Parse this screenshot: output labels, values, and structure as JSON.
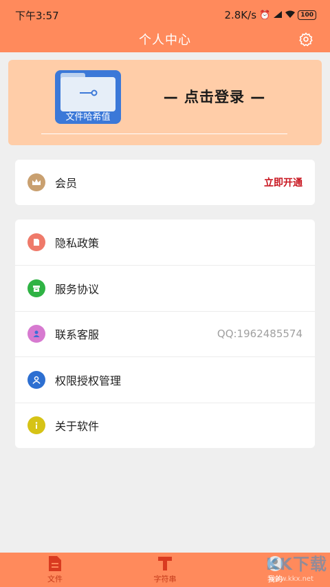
{
  "status_bar": {
    "time": "下午3:57",
    "speed": "2.8K/s",
    "battery": "100"
  },
  "header": {
    "title": "个人中心"
  },
  "login": {
    "app_icon_label": "文件哈希值",
    "prompt": "— 点击登录 —"
  },
  "member": {
    "label": "会员",
    "action": "立即开通"
  },
  "menu": {
    "items": [
      {
        "label": "隐私政策",
        "icon": "document-icon",
        "color": "#ef7a6a"
      },
      {
        "label": "服务协议",
        "icon": "archive-icon",
        "color": "#2fb344"
      },
      {
        "label": "联系客服",
        "icon": "contact-icon",
        "color": "#d77ad0",
        "value": "QQ:1962485574"
      },
      {
        "label": "权限授权管理",
        "icon": "user-icon",
        "color": "#2d6fd1"
      },
      {
        "label": "关于软件",
        "icon": "info-icon",
        "color": "#d6c316"
      }
    ]
  },
  "tab_bar": {
    "tabs": [
      {
        "label": "文件",
        "icon": "file-icon"
      },
      {
        "label": "字符串",
        "icon": "text-icon"
      },
      {
        "label": "我的",
        "icon": "profile-icon",
        "active": true
      }
    ]
  },
  "watermark": {
    "text": "KK下载",
    "sub": "www.kkx.net"
  },
  "colors": {
    "accent": "#ff8a5c",
    "card_bg": "#ffcda8",
    "vip_red": "#c8141e"
  }
}
